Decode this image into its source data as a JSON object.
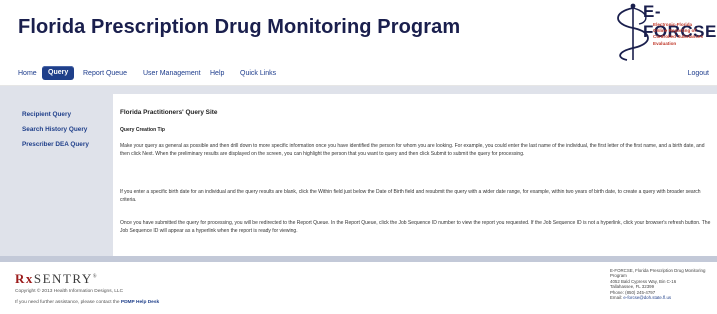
{
  "header": {
    "title": "Florida Prescription Drug Monitoring Program",
    "logo": {
      "brand": "E-FORCSE",
      "tagline": [
        "Electronic-Florida",
        "Online Reporting of",
        "Controlled Substances",
        "Evaluation"
      ],
      "icon": "caduceus-icon"
    }
  },
  "nav": {
    "items": [
      {
        "label": "Home"
      },
      {
        "label": "Query",
        "active": true
      },
      {
        "label": "Report Queue"
      },
      {
        "label": "User Management"
      },
      {
        "label": "Help"
      },
      {
        "label": "Quick Links"
      }
    ],
    "logout": "Logout"
  },
  "sidebar": {
    "items": [
      {
        "label": "Recipient Query"
      },
      {
        "label": "Search History Query"
      },
      {
        "label": "Prescriber DEA Query"
      }
    ]
  },
  "main": {
    "title": "Florida Practitioners' Query Site",
    "subtitle": "Query Creation Tip",
    "paragraphs": [
      "Make your query as general as possible and then drill down to more specific information once you have identified the person for whom you are looking. For example, you could enter the last name of the individual, the first letter of the first name, and a birth date, and then click Next. When the preliminary results are displayed on the screen, you can highlight the person that you want to query and then click Submit to submit the query for processing.",
      "If you enter a specific birth date for an individual and the query results are blank, click the Within field just below the Date of Birth field and resubmit the query with a wider date range, for example, within two years of birth date, to create a query with broader search criteria.",
      "Once you have submitted the query for processing, you will be redirected to the Report Queue. In the Report Queue, click the Job Sequence ID number to view the report you requested. If the Job Sequence ID is not a hyperlink, click your browser's refresh button. The Job Sequence ID will appear as a hyperlink when the report is ready for viewing."
    ]
  },
  "footer": {
    "logo_prefix": "Rx",
    "logo_text": "SENTRY",
    "logo_mark": "®",
    "copyright": "Copyright © 2013 Health Information Designs, LLC",
    "help_text": "If you need further assistance, please contact the ",
    "help_link": "PDMP Help Desk",
    "contact": [
      "E-FORCSE, Florida Prescription Drug Monitoring",
      "Program",
      "4052 Bald Cypress Way, Bin C-16",
      "Tallahassee, FL 32399",
      "Phone: (850) 245-4797"
    ],
    "email_label": "Email: ",
    "email": "e-forcse@doh.state.fl.us"
  },
  "colors": {
    "title": "#1a1f4d",
    "nav_active_bg": "#1f3f8a",
    "link": "#1f3f8a",
    "sidebar_bg": "#dfe2ea",
    "footer_band": "#c3c9d8",
    "logo_tag": "#c0392b"
  }
}
